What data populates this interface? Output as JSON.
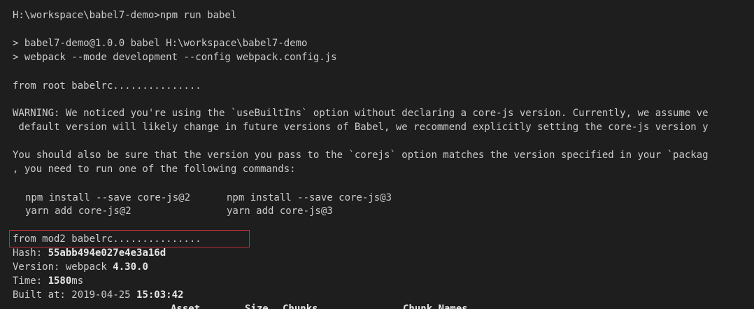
{
  "terminal": {
    "command_line": "H:\\workspace\\babel7-demo>npm run babel",
    "script_header_1": "> babel7-demo@1.0.0 babel H:\\workspace\\babel7-demo",
    "script_header_2": "> webpack --mode development --config webpack.config.js",
    "from_root": "from root babelrc...............",
    "warning_line_1": "WARNING: We noticed you're using the `useBuiltIns` option without declaring a core-js version. Currently, we assume ve",
    "warning_line_2": " default version will likely change in future versions of Babel, we recommend explicitly setting the core-js version y",
    "advice_line_1": "You should also be sure that the version you pass to the `corejs` option matches the version specified in your `packag",
    "advice_line_2": ", you need to run one of the following commands:",
    "cmd_npm2": "npm install --save core-js@2",
    "cmd_npm3": "npm install --save core-js@3",
    "cmd_yarn2": "yarn add core-js@2",
    "cmd_yarn3": "yarn add core-js@3",
    "from_mod2": "from mod2 babelrc...............",
    "hash_label": "Hash: ",
    "hash_value": "55abb494e027e4e3a16d",
    "version_label": "Version: webpack ",
    "version_value": "4.30.0",
    "time_label": "Time: ",
    "time_value": "1580",
    "time_unit": "ms",
    "built_label": "Built at: 2019-04-25 ",
    "built_time": "15:03:42",
    "table_headers": {
      "asset": "Asset",
      "size": "Size",
      "chunks": "Chunks",
      "chunk_names": "Chunk Names"
    }
  },
  "colors": {
    "background": "#1e1e1e",
    "text": "#cccccc",
    "highlight_border": "#c0303a"
  }
}
